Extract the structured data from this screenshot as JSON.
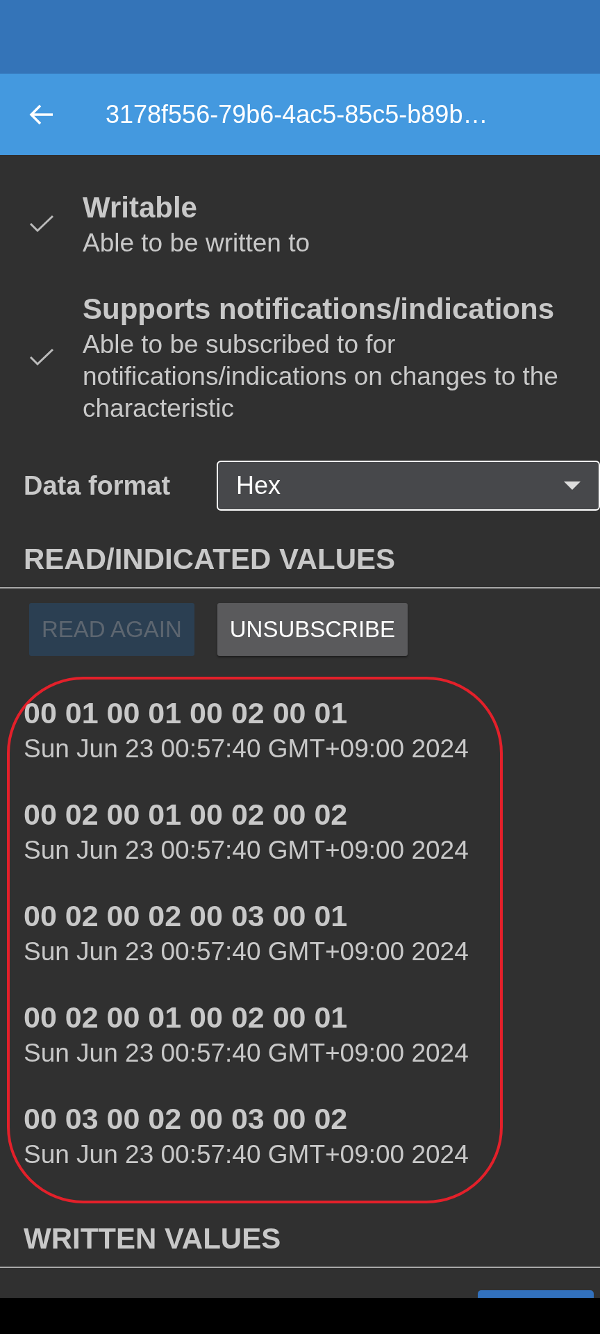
{
  "app_bar": {
    "title": "3178f556-79b6-4ac5-85c5-b89b…"
  },
  "properties": [
    {
      "title": "Writable",
      "description": "Able to be written to",
      "checked": true
    },
    {
      "title": "Supports notifications/indications",
      "description": "Able to be subscribed to for notifications/indications on changes to the characteristic",
      "checked": true
    }
  ],
  "data_format": {
    "label": "Data format",
    "value": "Hex"
  },
  "read_section": {
    "heading": "READ/INDICATED VALUES",
    "buttons": [
      {
        "label": "READ AGAIN",
        "disabled": true
      },
      {
        "label": "UNSUBSCRIBE",
        "disabled": false
      }
    ],
    "values": [
      {
        "value": "00 01 00 01 00 02 00 01",
        "time": "Sun Jun 23 00:57:40 GMT+09:00 2024"
      },
      {
        "value": "00 02 00 01 00 02 00 02",
        "time": "Sun Jun 23 00:57:40 GMT+09:00 2024"
      },
      {
        "value": "00 02 00 02 00 03 00 01",
        "time": "Sun Jun 23 00:57:40 GMT+09:00 2024"
      },
      {
        "value": "00 02 00 01 00 02 00 01",
        "time": "Sun Jun 23 00:57:40 GMT+09:00 2024"
      },
      {
        "value": "00 03 00 02 00 03 00 02",
        "time": "Sun Jun 23 00:57:40 GMT+09:00 2024"
      }
    ]
  },
  "written_section": {
    "heading": "WRITTEN VALUES"
  }
}
